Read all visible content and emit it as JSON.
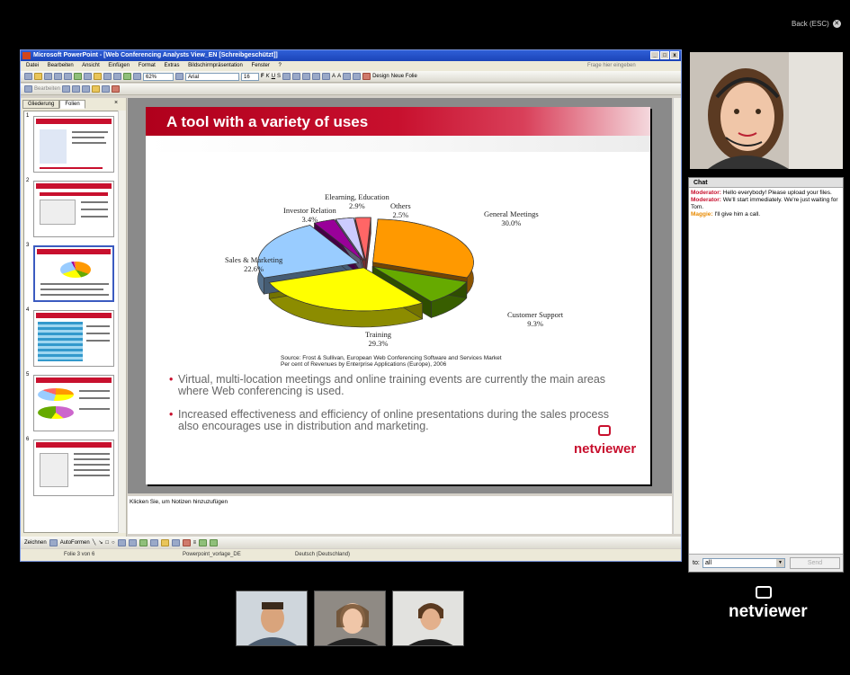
{
  "nav": {
    "back_label": "Back (ESC)"
  },
  "ppt": {
    "window_title": "Microsoft PowerPoint - [Web Conferencing Analysts View_EN [Schreibgeschützt]]",
    "menu": [
      "Datei",
      "Bearbeiten",
      "Ansicht",
      "Einfügen",
      "Format",
      "Extras",
      "Bildschirmpräsentation",
      "Fenster",
      "?"
    ],
    "help_placeholder": "Frage hier eingeben",
    "zoom": "62%",
    "font": "Arial",
    "font_size": "16",
    "design_label": "Design",
    "new_slide_label": "Neue Folie",
    "review_label": "Bearbeiten",
    "tabs": [
      "Gliederung",
      "Folien"
    ],
    "thumb_numbers": [
      "1",
      "2",
      "3",
      "4",
      "5",
      "6"
    ],
    "notes_placeholder": "Klicken Sie, um Notizen hinzuzufügen",
    "draw_label": "Zeichnen",
    "autoshapes_label": "AutoFormen",
    "status": {
      "slide": "Folie 3 von 6",
      "template": "Powerpoint_vorlage_DE",
      "language": "Deutsch (Deutschland)"
    }
  },
  "slide": {
    "title": "A tool with a variety of uses",
    "source_line1": "Source: Frost & Sullivan, European Web Conferencing Software and Services Market",
    "source_line2": "Per cent of Revenues by Enterprise Applications (Europe), 2006",
    "bullets": [
      "Virtual, multi-location meetings and online training events are currently the main areas where Web conferencing is used.",
      "Increased effectiveness and efficiency of online presentations during the sales process also encourages use in distribution and marketing."
    ],
    "logo_text": "netviewer"
  },
  "chart_data": {
    "type": "pie",
    "labels": [
      "General Meetings",
      "Customer Support",
      "Training",
      "Sales & Marketing",
      "Investor Relation",
      "Elearning, Education",
      "Others"
    ],
    "values": [
      30.0,
      9.3,
      29.3,
      22.6,
      3.4,
      2.9,
      2.5
    ],
    "value_labels": [
      "30.0%",
      "9.3%",
      "29.3%",
      "22.6%",
      "3.4%",
      "2.9%",
      "2.5%"
    ],
    "colors": [
      "#ff9900",
      "#66aa00",
      "#ffff00",
      "#99ccff",
      "#990099",
      "#ccccff",
      "#ff6666"
    ]
  },
  "chat": {
    "header": "Chat",
    "messages": [
      {
        "author": "Moderator:",
        "text": " Hello everybody! Please upload your files.",
        "role": "mod"
      },
      {
        "author": "Moderator:",
        "text": " We'll start immediately. We're just waiting for Tom.",
        "role": "mod"
      },
      {
        "author": "Maggie:",
        "text": " I'll give him a call.",
        "role": "mag"
      }
    ],
    "to_label": "to:",
    "recipient": "all",
    "send_label": "Send"
  },
  "brand": {
    "logo_text": "netviewer"
  }
}
